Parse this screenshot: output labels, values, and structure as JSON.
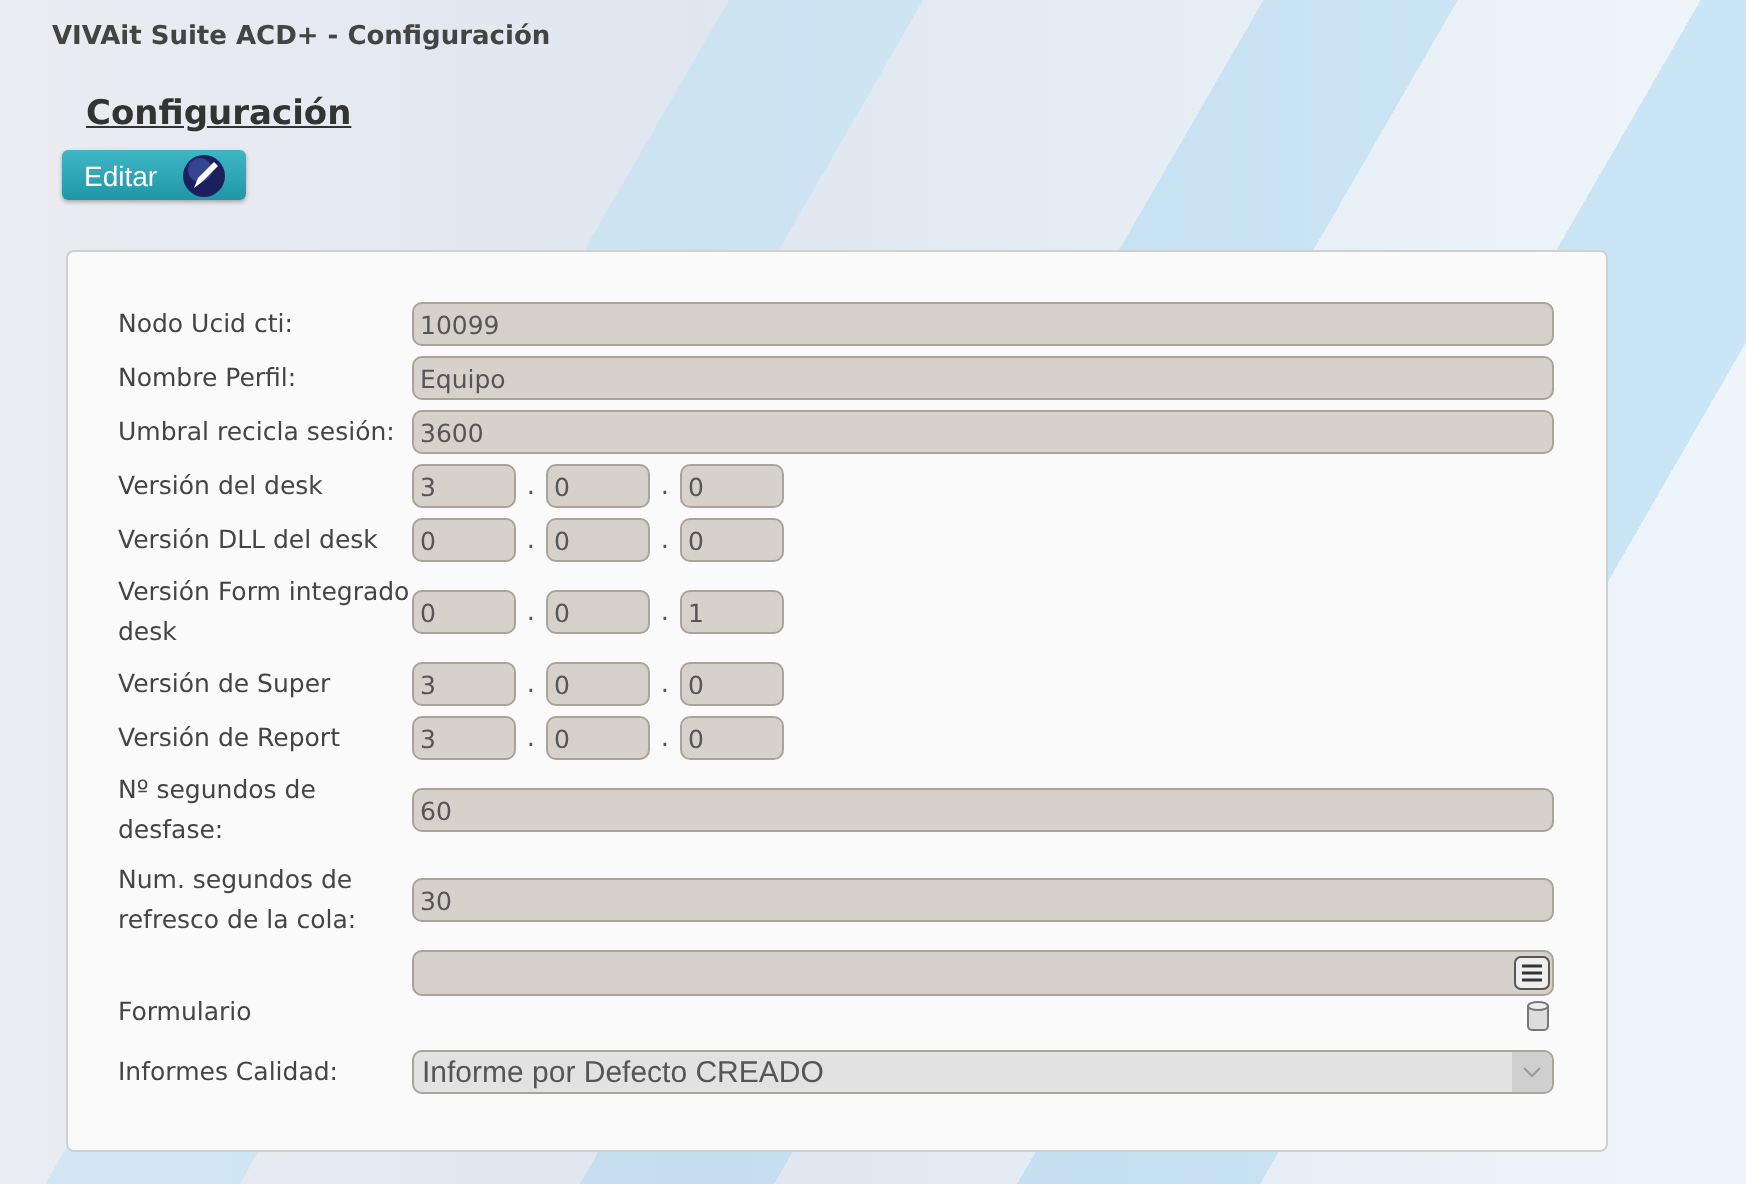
{
  "window": {
    "title": "VIVAit Suite ACD+ - Configuración"
  },
  "heading": "Configuración",
  "edit_button": {
    "label": "Editar"
  },
  "fields": [
    {
      "kind": "text",
      "label": "Nodo Ucid cti:",
      "value": "10099"
    },
    {
      "kind": "text",
      "label": "Nombre Perfil:",
      "value": "Equipo"
    },
    {
      "kind": "text",
      "label": "Umbral recicla sesión:",
      "value": "3600"
    },
    {
      "kind": "version",
      "label": "Versión del desk",
      "parts": [
        "3",
        "0",
        "0"
      ],
      "separator": "."
    },
    {
      "kind": "version",
      "label": "Versión DLL del desk",
      "parts": [
        "0",
        "0",
        "0"
      ],
      "separator": "."
    },
    {
      "kind": "version",
      "label": "Versión Form integrado desk",
      "parts": [
        "0",
        "0",
        "1"
      ],
      "separator": "."
    },
    {
      "kind": "version",
      "label": "Versión de Super",
      "parts": [
        "3",
        "0",
        "0"
      ],
      "separator": "."
    },
    {
      "kind": "version",
      "label": "Versión de Report",
      "parts": [
        "3",
        "0",
        "0"
      ],
      "separator": "."
    },
    {
      "kind": "text",
      "label": "Nº segundos de desfase:",
      "value": "60"
    },
    {
      "kind": "text",
      "label": "Num. segundos de refresco de la cola:",
      "value": "30"
    },
    {
      "kind": "form",
      "label": "Formulario"
    },
    {
      "kind": "select",
      "label": "Informes Calidad:",
      "value": "Informe por Defecto CREADO"
    }
  ]
}
